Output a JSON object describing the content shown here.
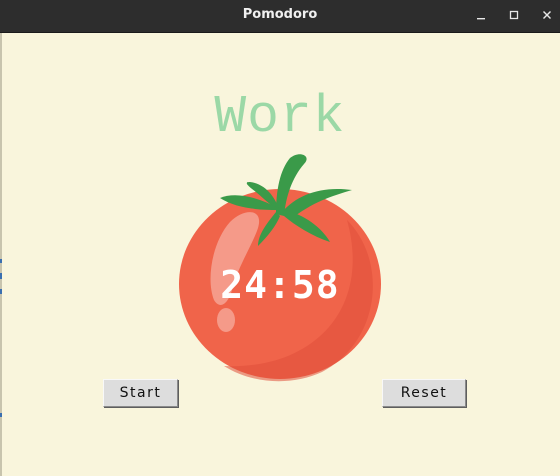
{
  "window": {
    "title": "Pomodoro",
    "controls": {
      "minimize_icon": "minimize-icon",
      "maximize_icon": "maximize-icon",
      "close_icon": "close-icon"
    }
  },
  "timer": {
    "mode_label": "Work",
    "mode_color": "#9bd8a6",
    "time_display": "24:58"
  },
  "buttons": {
    "start_label": "Start",
    "reset_label": "Reset"
  },
  "colors": {
    "background": "#f9f5dc",
    "tomato": "#f0644a",
    "leaf": "#3a9a49"
  }
}
